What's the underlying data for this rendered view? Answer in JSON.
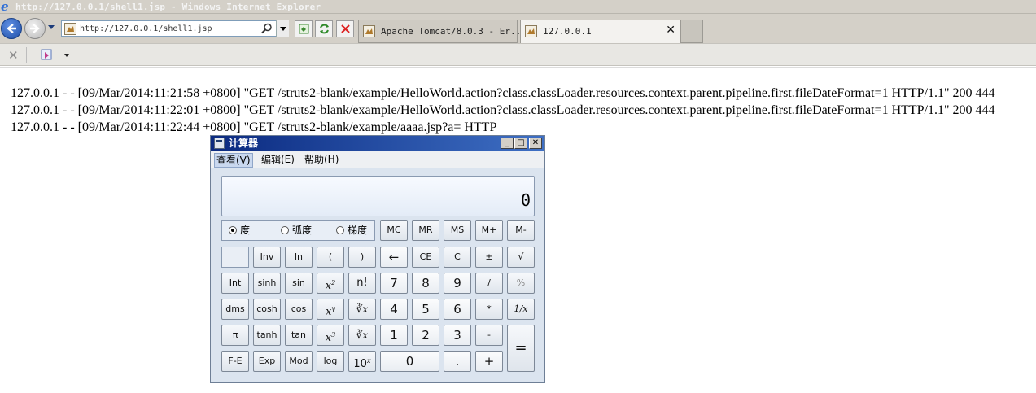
{
  "window": {
    "title": "http://127.0.0.1/shell1.jsp - Windows Internet Explorer"
  },
  "address_bar": {
    "url": "http://127.0.0.1/shell1.jsp"
  },
  "tabs": [
    {
      "label": "Apache Tomcat/8.0.3 - Er...",
      "active": false
    },
    {
      "label": "127.0.0.1",
      "active": true,
      "close": "✕"
    }
  ],
  "page": {
    "text": "127.0.0.1 - - [09/Mar/2014:11:21:58 +0800] \"GET /struts2-blank/example/HelloWorld.action?class.classLoader.resources.context.parent.pipeline.first.fileDateFormat=1 HTTP/1.1\" 200 444 127.0.0.1 - - [09/Mar/2014:11:22:01 +0800] \"GET /struts2-blank/example/HelloWorld.action?class.classLoader.resources.context.parent.pipeline.first.fileDateFormat=1 HTTP/1.1\" 200 444 127.0.0.1 - - [09/Mar/2014:11:22:44 +0800] \"GET /struts2-blank/example/aaaa.jsp?a= HTTP"
  },
  "calculator": {
    "title": "计算器",
    "menu": {
      "view": "查看(V)",
      "edit": "编辑(E)",
      "help": "帮助(H)"
    },
    "display": "0",
    "angle_modes": [
      "度",
      "弧度",
      "梯度"
    ],
    "selected_angle": "度",
    "memory": [
      "MC",
      "MR",
      "MS",
      "M+",
      "M-"
    ],
    "keys": {
      "inv": "Inv",
      "ln": "ln",
      "lparen": "(",
      "rparen": ")",
      "back": "←",
      "ce": "CE",
      "c": "C",
      "pm": "±",
      "sqrt": "√",
      "int": "Int",
      "sinh": "sinh",
      "sin": "sin",
      "x2": "x",
      "x2sup": "2",
      "fact": "n!",
      "n7": "7",
      "n8": "8",
      "n9": "9",
      "div": "/",
      "pct": "%",
      "dms": "dms",
      "cosh": "cosh",
      "cos": "cos",
      "xy": "x",
      "xysup": "y",
      "yroot": "∛x",
      "n4": "4",
      "n5": "5",
      "n6": "6",
      "mul": "*",
      "recip": "1/x",
      "pi": "π",
      "tanh": "tanh",
      "tan": "tan",
      "x3": "x",
      "x3sup": "3",
      "cbrt": "∛x",
      "n1": "1",
      "n2": "2",
      "n3": "3",
      "sub": "-",
      "eq": "=",
      "fe": "F-E",
      "exp": "Exp",
      "mod": "Mod",
      "log": "log",
      "tenx": "10",
      "tenxsup": "x",
      "n0": "0",
      "dot": ".",
      "add": "+"
    }
  }
}
